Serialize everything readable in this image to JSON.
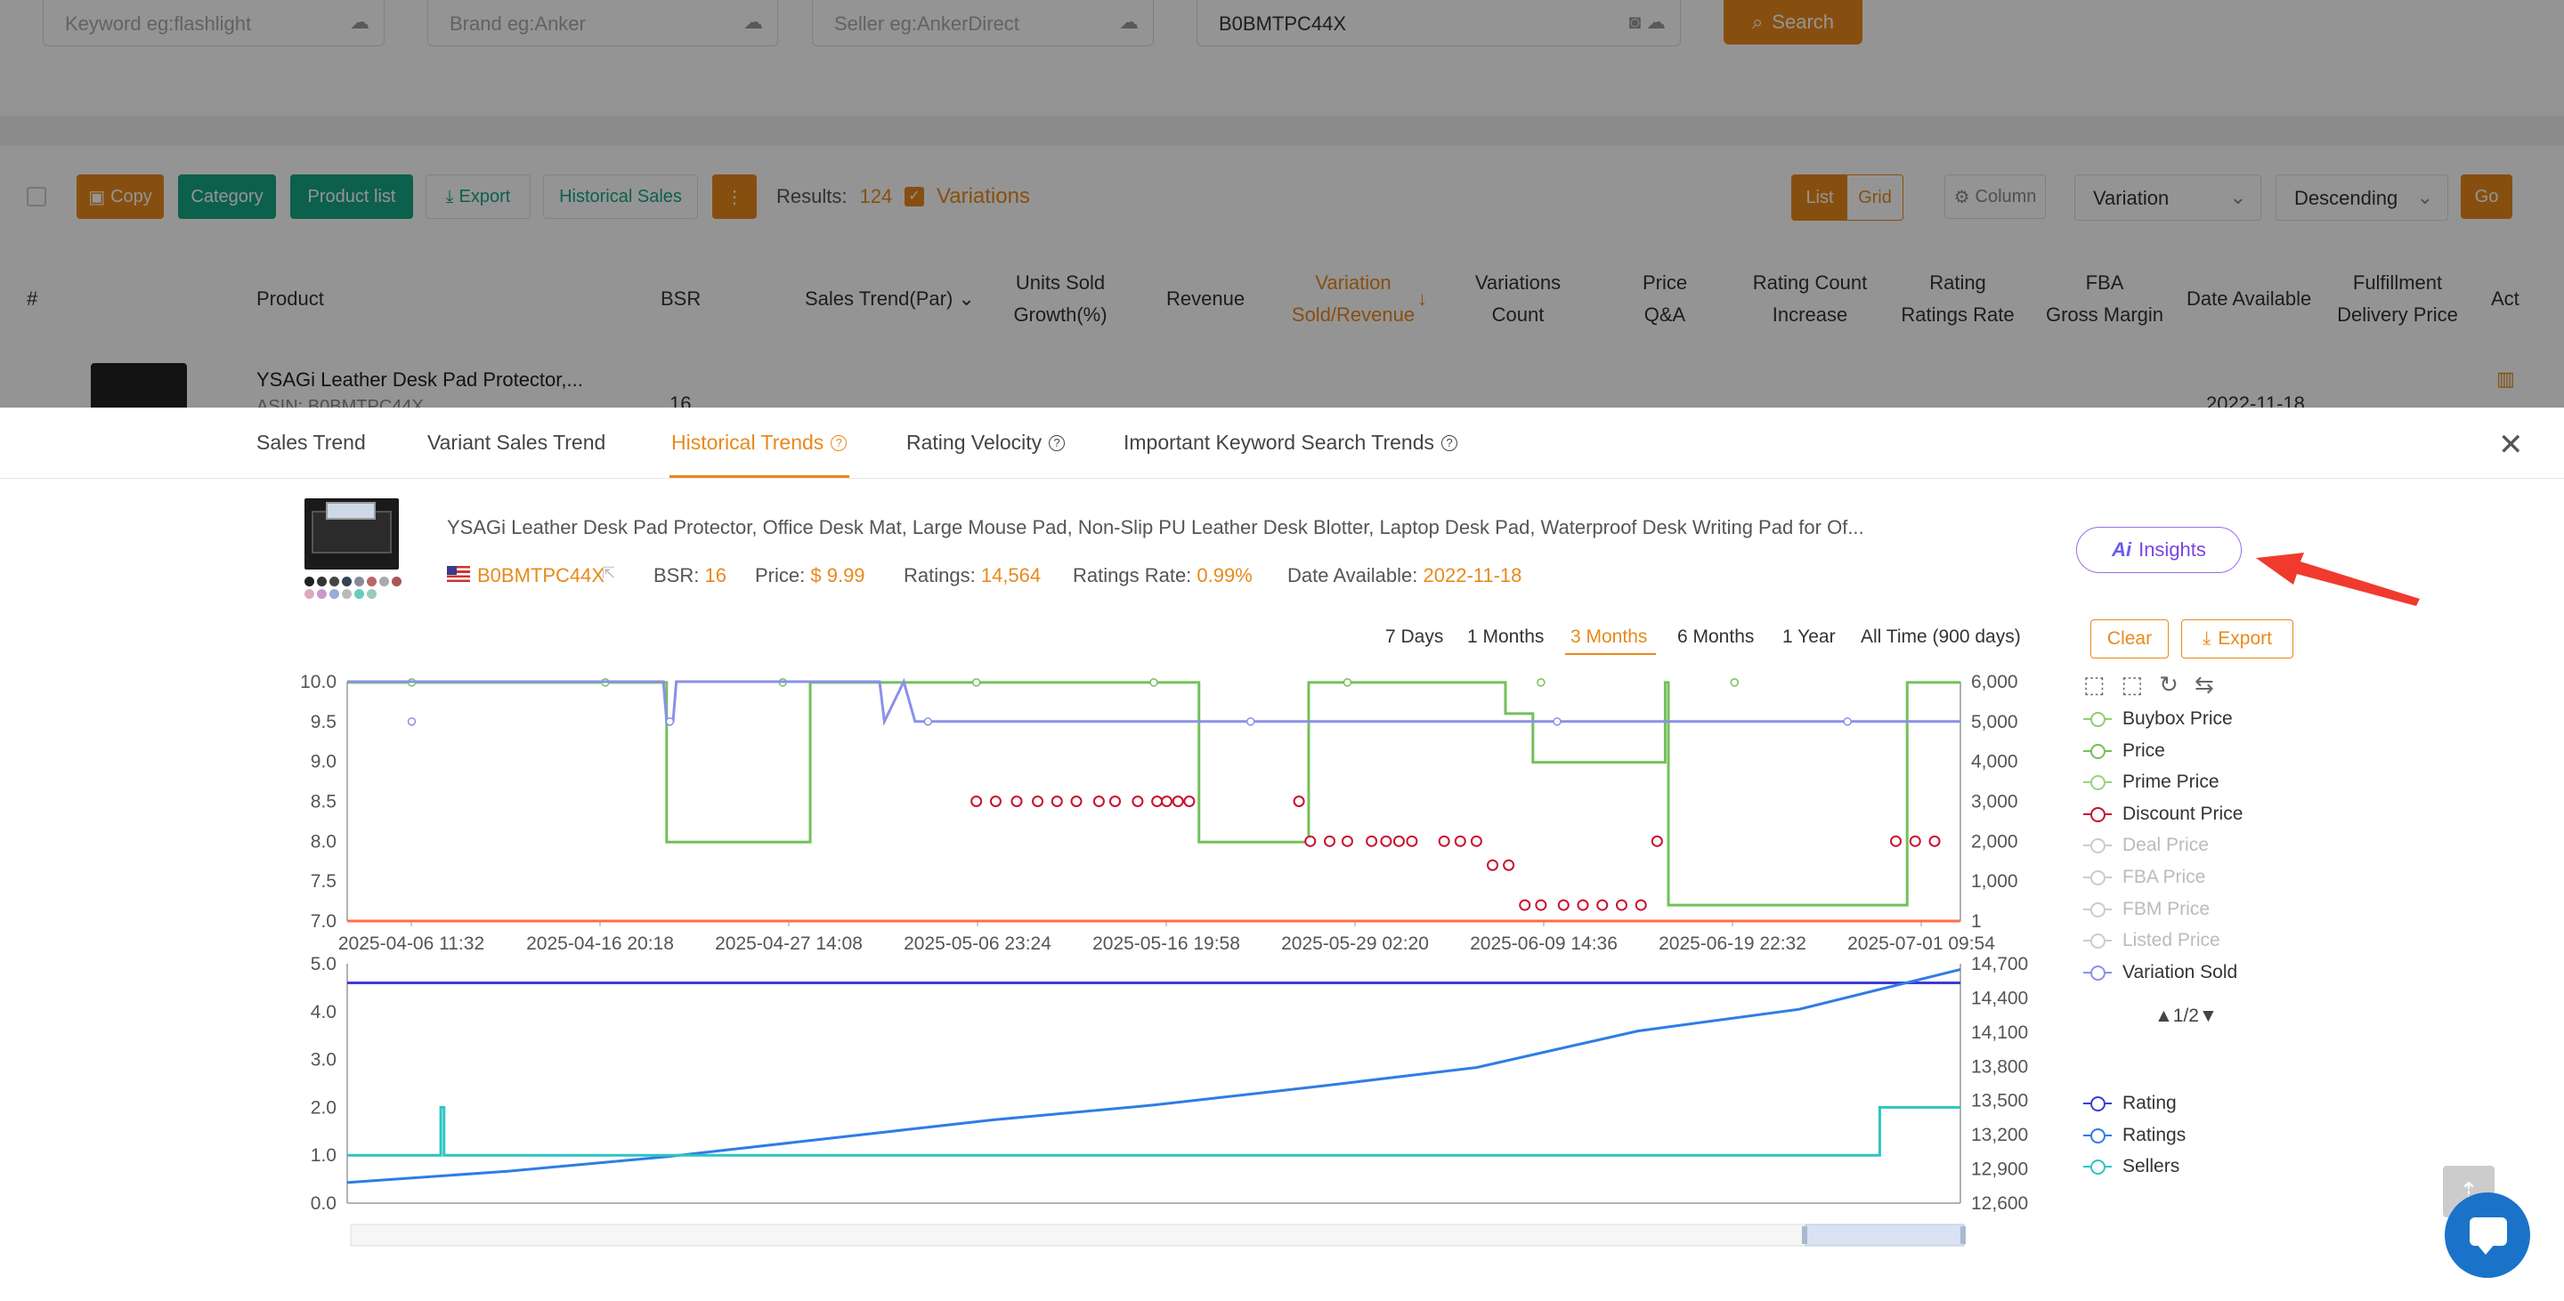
{
  "search": {
    "keyword_placeholder": "Keyword eg:flashlight",
    "brand_placeholder": "Brand eg:Anker",
    "seller_placeholder": "Seller eg:AnkerDirect",
    "asin_value": "B0BMTPC44X",
    "search_label": "Search"
  },
  "toolbar": {
    "copy": "Copy",
    "category": "Category",
    "product_list": "Product list",
    "export": "Export",
    "historical_sales": "Historical Sales",
    "results_label": "Results:",
    "results_count": "124",
    "variations": "Variations",
    "list": "List",
    "grid": "Grid",
    "column": "Column",
    "variation_select": "Variation",
    "order_select": "Descending",
    "go": "Go"
  },
  "table": {
    "headers": {
      "index": "#",
      "product": "Product",
      "bsr": "BSR",
      "sales_trend": "Sales Trend(Par)",
      "units_sold_growth_1": "Units Sold",
      "units_sold_growth_2": "Growth(%)",
      "revenue": "Revenue",
      "variation_sold_1": "Variation",
      "variation_sold_2": "Sold/Revenue",
      "variations_count_1": "Variations",
      "variations_count_2": "Count",
      "price_qa_1": "Price",
      "price_qa_2": "Q&A",
      "rating_count_1": "Rating Count",
      "rating_count_2": "Increase",
      "rating_rate_1": "Rating",
      "rating_rate_2": "Ratings Rate",
      "fba_margin_1": "FBA",
      "fba_margin_2": "Gross Margin",
      "date_available": "Date Available",
      "fulfillment_1": "Fulfillment",
      "fulfillment_2": "Delivery Price",
      "action": "Act"
    },
    "row": {
      "title": "YSAGi Leather Desk Pad Protector,...",
      "asin": "ASIN: B0BMTPC44X",
      "bsr": "16",
      "date": "2022-11-18"
    }
  },
  "drawer": {
    "tabs": [
      "Sales Trend",
      "Variant Sales Trend",
      "Historical Trends",
      "Rating Velocity",
      "Important Keyword Search Trends"
    ],
    "active_tab": "Historical Trends",
    "product": {
      "title": "YSAGi Leather Desk Pad Protector, Office Desk Mat, Large Mouse Pad, Non-Slip PU Leather Desk Blotter, Laptop Desk Pad, Waterproof Desk Writing Pad for Of...",
      "asin": "B0BMTPC44X",
      "bsr_label": "BSR:",
      "bsr": "16",
      "price_label": "Price:",
      "price": "$ 9.99",
      "ratings_label": "Ratings:",
      "ratings": "14,564",
      "rate_label": "Ratings Rate:",
      "rate": "0.99%",
      "date_label": "Date Available:",
      "date": "2022-11-18"
    },
    "insights_label": "Insights",
    "ranges": [
      "7 Days",
      "1 Months",
      "3 Months",
      "6 Months",
      "1 Year",
      "All Time (900 days)"
    ],
    "active_range": "3 Months",
    "clear": "Clear",
    "export": "Export",
    "pager": "1/2",
    "legend_top": [
      {
        "name": "Buybox Price",
        "color": "#91cc75",
        "active": true
      },
      {
        "name": "Price",
        "color": "#73c05a",
        "active": true
      },
      {
        "name": "Prime Price",
        "color": "#9bd27e",
        "active": true
      },
      {
        "name": "Discount Price",
        "color": "#c8102e",
        "active": true
      },
      {
        "name": "Deal Price",
        "color": "#cccccc",
        "active": false
      },
      {
        "name": "FBA Price",
        "color": "#cccccc",
        "active": false
      },
      {
        "name": "FBM Price",
        "color": "#cccccc",
        "active": false
      },
      {
        "name": "Listed Price",
        "color": "#cccccc",
        "active": false
      },
      {
        "name": "Variation Sold",
        "color": "#8a90e8",
        "active": true
      }
    ],
    "legend_bottom": [
      {
        "name": "Rating",
        "color": "#3b3bd6"
      },
      {
        "name": "Ratings",
        "color": "#2f7ce6"
      },
      {
        "name": "Sellers",
        "color": "#2ec4c4"
      }
    ]
  },
  "chart_data": [
    {
      "type": "line",
      "title": "",
      "x_ticks": [
        "2025-04-06 11:32",
        "2025-04-16 20:18",
        "2025-04-27 14:08",
        "2025-05-06 23:24",
        "2025-05-16 19:58",
        "2025-05-29 02:20",
        "2025-06-09 14:36",
        "2025-06-19 22:32",
        "2025-07-01 09:54"
      ],
      "y_left_ticks": [
        "10.0",
        "9.5",
        "9.0",
        "8.5",
        "8.0",
        "7.5",
        "7.0"
      ],
      "y_left_range": [
        7.0,
        10.0
      ],
      "y_right_ticks": [
        "6,000",
        "5,000",
        "4,000",
        "3,000",
        "2,000",
        "1,000",
        "1"
      ],
      "y_right_range": [
        1,
        6000
      ],
      "series": [
        {
          "name": "Price",
          "color": "#73c05a",
          "step": true,
          "x": [
            0,
            0.198,
            0.198,
            0.287,
            0.287,
            0.528,
            0.528,
            0.596,
            0.596,
            0.718,
            0.718,
            0.735,
            0.735,
            0.817,
            0.817,
            0.819,
            0.819,
            0.967,
            0.967,
            1.0
          ],
          "values": [
            9.99,
            9.99,
            7.99,
            7.99,
            9.99,
            9.99,
            7.99,
            7.99,
            9.99,
            9.99,
            9.6,
            9.6,
            8.99,
            8.99,
            9.99,
            9.99,
            7.2,
            7.2,
            9.99,
            9.99
          ]
        },
        {
          "name": "Variation Sold",
          "color": "#8a90e8",
          "x": [
            0,
            0.196,
            0.198,
            0.202,
            0.204,
            0.33,
            0.333,
            0.345,
            0.352,
            1.0
          ],
          "values": [
            6000,
            6000,
            5000,
            5000,
            6000,
            6000,
            5000,
            6000,
            5000,
            5000
          ]
        },
        {
          "name": "Discount Price",
          "color": "#c8102e",
          "marker": "circle-only",
          "x": [
            0.39,
            0.402,
            0.415,
            0.428,
            0.44,
            0.452,
            0.466,
            0.476,
            0.49,
            0.502,
            0.508,
            0.515,
            0.522,
            0.59,
            0.597,
            0.609,
            0.62,
            0.635,
            0.644,
            0.652,
            0.66,
            0.68,
            0.69,
            0.7,
            0.71,
            0.72,
            0.73,
            0.74,
            0.754,
            0.766,
            0.778,
            0.79,
            0.802,
            0.812,
            0.96,
            0.972,
            0.984
          ],
          "values": [
            8.5,
            8.5,
            8.5,
            8.5,
            8.5,
            8.5,
            8.5,
            8.5,
            8.5,
            8.5,
            8.5,
            8.5,
            8.5,
            8.5,
            8.0,
            8.0,
            8.0,
            8.0,
            8.0,
            8.0,
            8.0,
            8.0,
            8.0,
            8.0,
            7.7,
            7.7,
            7.2,
            7.2,
            7.2,
            7.2,
            7.2,
            7.2,
            7.2,
            8.0,
            8.0,
            8.0,
            8.0
          ]
        },
        {
          "name": "Buybox Price",
          "color": "#ff6d4a",
          "values_note": "",
          "x": [
            0,
            1.0
          ],
          "values": [
            7.0,
            7.0
          ]
        }
      ]
    },
    {
      "type": "line",
      "title": "",
      "y_left_ticks": [
        "5.0",
        "4.0",
        "3.0",
        "2.0",
        "1.0",
        "0.0"
      ],
      "y_left_range": [
        0,
        5
      ],
      "y_right_ticks": [
        "14,700",
        "14,400",
        "14,100",
        "13,800",
        "13,500",
        "13,200",
        "12,900",
        "12,600"
      ],
      "y_right_range": [
        12600,
        14700
      ],
      "series": [
        {
          "name": "Rating",
          "color": "#3b3bd6",
          "axis": "left",
          "x": [
            0,
            1.0
          ],
          "values": [
            4.6,
            4.6
          ]
        },
        {
          "name": "Ratings",
          "color": "#2f7ce6",
          "axis": "right",
          "x": [
            0,
            0.1,
            0.2,
            0.3,
            0.4,
            0.5,
            0.6,
            0.7,
            0.8,
            0.9,
            1.0
          ],
          "values": [
            12780,
            12880,
            13010,
            13170,
            13330,
            13460,
            13620,
            13790,
            14110,
            14300,
            14650
          ]
        },
        {
          "name": "Sellers",
          "color": "#2ec4c4",
          "axis": "left",
          "x": [
            0,
            0.058,
            0.058,
            0.06,
            0.06,
            0.95,
            0.95,
            1.0
          ],
          "values": [
            1,
            1,
            2,
            2,
            1,
            1,
            2,
            2
          ]
        }
      ]
    }
  ]
}
